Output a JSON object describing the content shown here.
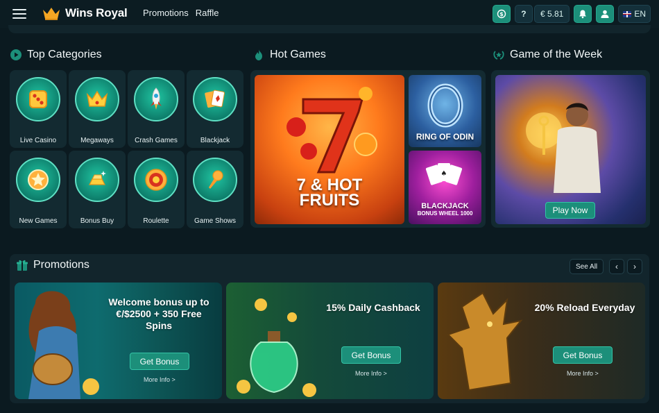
{
  "header": {
    "brand": "Wins Royal",
    "nav": [
      "Promotions",
      "Raffle"
    ],
    "balance": "€ 5.81",
    "help": "?",
    "language": "EN"
  },
  "sections": {
    "top_categories": "Top Categories",
    "hot_games": "Hot Games",
    "game_of_week": "Game of the Week",
    "promotions": "Promotions"
  },
  "categories": [
    {
      "label": "Live Casino",
      "icon": "dice-icon"
    },
    {
      "label": "Megaways",
      "icon": "crown-icon"
    },
    {
      "label": "Crash Games",
      "icon": "rocket-icon"
    },
    {
      "label": "Blackjack",
      "icon": "cards-icon"
    },
    {
      "label": "New Games",
      "icon": "star-icon"
    },
    {
      "label": "Bonus Buy",
      "icon": "gold-bar-icon"
    },
    {
      "label": "Roulette",
      "icon": "roulette-icon"
    },
    {
      "label": "Game Shows",
      "icon": "microphone-icon"
    }
  ],
  "hot_games": {
    "main": {
      "title_line1": "7 & HOT",
      "title_line2": "FRUITS"
    },
    "odin": {
      "title": "RING OF ODIN"
    },
    "blackjack": {
      "title": "BLACKJACK",
      "subtitle": "BONUS WHEEL 1000"
    }
  },
  "game_of_week": {
    "button": "Play Now"
  },
  "promotions": {
    "see_all": "See All",
    "prev": "‹",
    "next": "›",
    "cards": [
      {
        "title": "Welcome bonus up to €/$2500 + 350 Free Spins",
        "button": "Get Bonus",
        "more": "More Info >"
      },
      {
        "title": "15% Daily Cashback",
        "button": "Get Bonus",
        "more": "More Info >"
      },
      {
        "title": "20% Reload Everyday",
        "button": "Get Bonus",
        "more": "More Info >"
      }
    ]
  },
  "colors": {
    "background": "#0b1a20",
    "panel": "#132a31",
    "accent": "#1c8f7a",
    "brand_gold": "#f5a623"
  }
}
